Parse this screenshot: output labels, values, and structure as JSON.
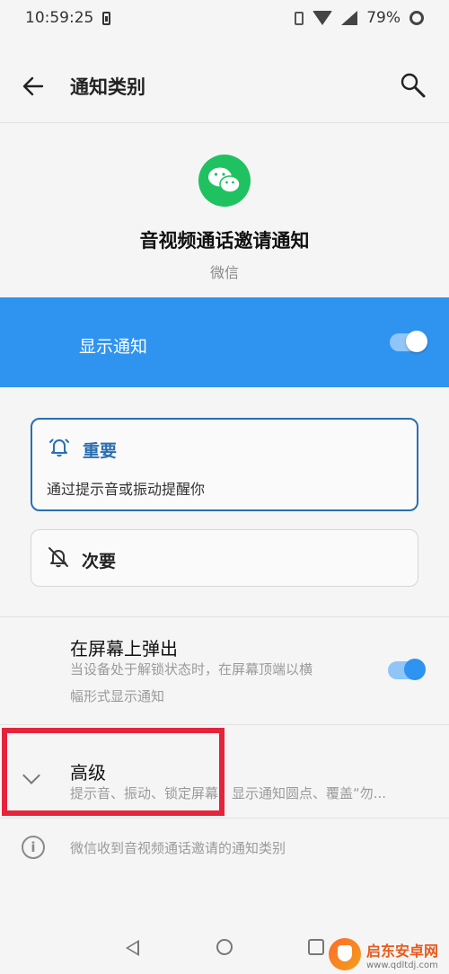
{
  "status_bar": {
    "time": "10:59:25",
    "battery": "79%"
  },
  "app_bar": {
    "title": "通知类别"
  },
  "header": {
    "channel_name": "音视频通话邀请通知",
    "app_name": "微信"
  },
  "show_notifications": {
    "label": "显示通知",
    "enabled": true
  },
  "importance": {
    "important": {
      "title": "重要",
      "description": "通过提示音或振动提醒你",
      "selected": true
    },
    "secondary": {
      "title": "次要",
      "selected": false
    }
  },
  "popup": {
    "title": "在屏幕上弹出",
    "subtitle_line1": "当设备处于解锁状态时，在屏幕顶端以横",
    "subtitle_line2": "幅形式显示通知",
    "enabled": true
  },
  "advanced": {
    "title": "高级",
    "subtitle": "提示音、振动、锁定屏幕、显示通知圆点、覆盖“勿..."
  },
  "info": {
    "text": "微信收到音视频通话邀请的通知类别"
  },
  "watermark": {
    "title": "启东安卓网",
    "url": "www.qdltdj.com"
  },
  "colors": {
    "accent": "#2f93f0",
    "important_blue": "#2a6fb0",
    "wechat_green": "#1fc160",
    "highlight_red": "#e5243b"
  }
}
